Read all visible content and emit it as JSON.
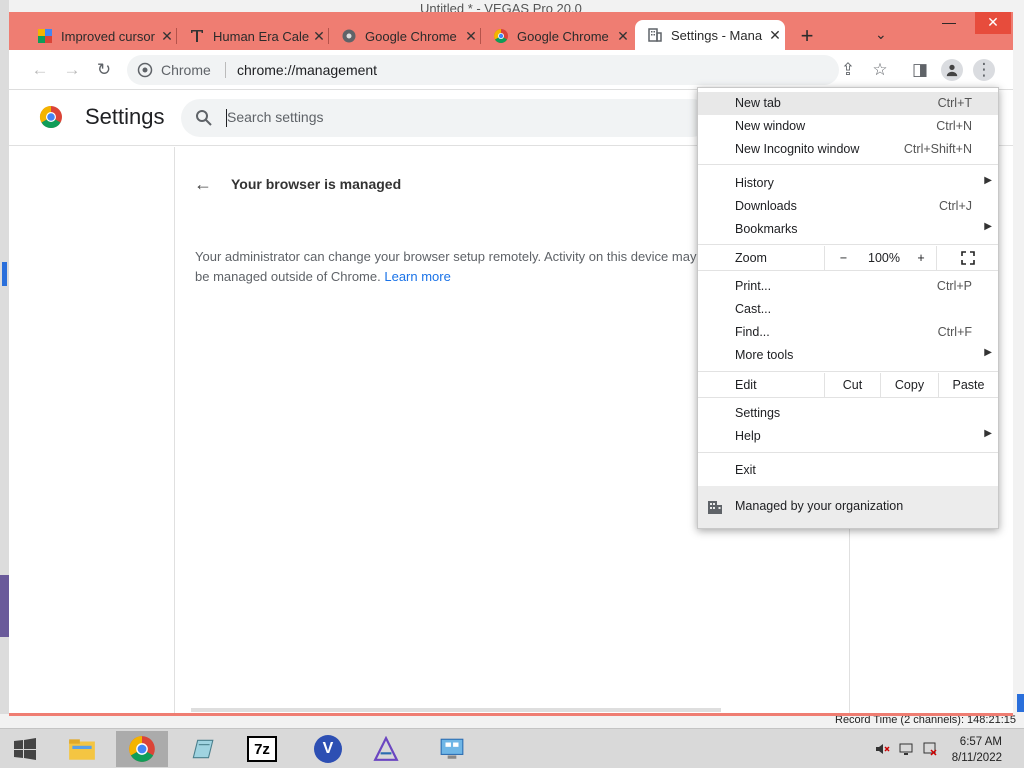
{
  "background": {
    "window_title": "Untitled * - VEGAS Pro 20.0",
    "record_time": "Record Time (2 channels): 148:21:15"
  },
  "browser": {
    "tabs": [
      {
        "title": "Improved cursor",
        "favicon": "docs-icon"
      },
      {
        "title": "Human Era Cale",
        "favicon": "text-t-icon"
      },
      {
        "title": "Google Chrome",
        "favicon": "globe-icon"
      },
      {
        "title": "Google Chrome",
        "favicon": "chrome-icon"
      },
      {
        "title": "Settings - Mana",
        "favicon": "building-icon",
        "active": true
      }
    ],
    "window_controls": {
      "minimize": "—",
      "maximize": "☐",
      "close": "✕"
    },
    "omnibox": {
      "site": "Chrome",
      "url": "chrome://management"
    }
  },
  "settings": {
    "title": "Settings",
    "search_placeholder": "Search settings",
    "heading": "Your browser is managed",
    "description": "Your administrator can change your browser setup remotely. Activity on this device may also be managed outside of Chrome.",
    "learn_more": "Learn more"
  },
  "menu": {
    "items_group1": [
      {
        "label": "New tab",
        "shortcut": "Ctrl+T"
      },
      {
        "label": "New window",
        "shortcut": "Ctrl+N"
      },
      {
        "label": "New Incognito window",
        "shortcut": "Ctrl+Shift+N"
      }
    ],
    "items_group2": [
      {
        "label": "History",
        "shortcut": ""
      },
      {
        "label": "Downloads",
        "shortcut": "Ctrl+J"
      },
      {
        "label": "Bookmarks",
        "shortcut": ""
      }
    ],
    "zoom": {
      "label": "Zoom",
      "minus": "−",
      "value": "100%",
      "plus": "+"
    },
    "items_group3": [
      {
        "label": "Print...",
        "shortcut": "Ctrl+P"
      },
      {
        "label": "Cast...",
        "shortcut": ""
      },
      {
        "label": "Find...",
        "shortcut": "Ctrl+F"
      },
      {
        "label": "More tools",
        "shortcut": ""
      }
    ],
    "edit": {
      "label": "Edit",
      "cut": "Cut",
      "copy": "Copy",
      "paste": "Paste"
    },
    "items_group4": [
      {
        "label": "Settings"
      },
      {
        "label": "Help"
      }
    ],
    "exit": "Exit",
    "managed": "Managed by your organization"
  },
  "taskbar": {
    "time": "6:57 AM",
    "date": "8/11/2022"
  }
}
